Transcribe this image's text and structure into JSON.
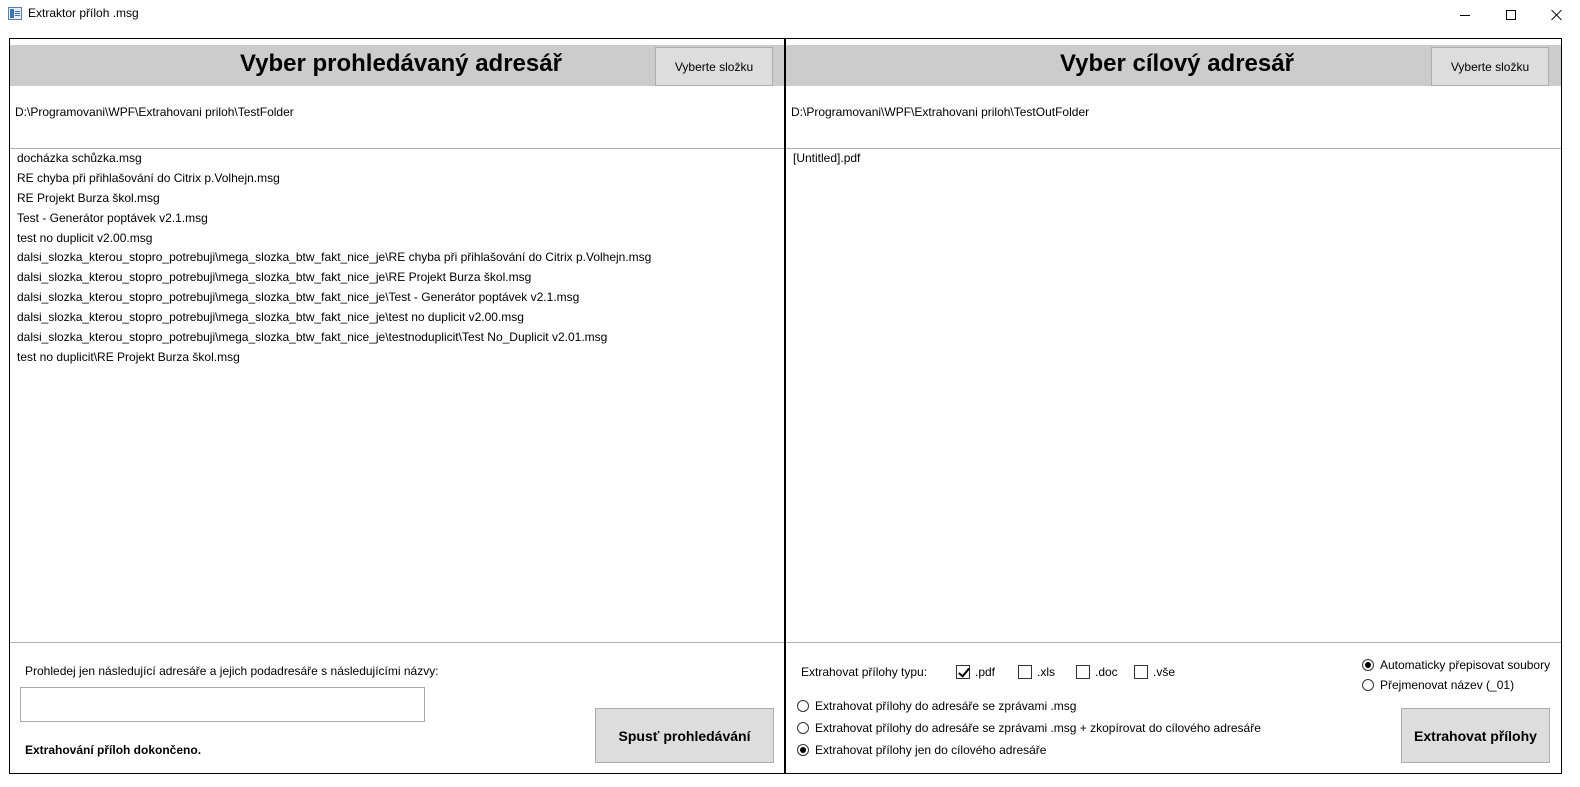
{
  "window": {
    "title": "Extraktor příloh .msg",
    "minimize_icon": "minimize-icon",
    "maximize_icon": "maximize-icon",
    "close_icon": "close-icon"
  },
  "left_panel": {
    "title": "Vyber prohledávaný adresář",
    "browse_label": "Vyberte složku",
    "path": "D:\\Programovani\\WPF\\Extrahovani priloh\\TestFolder",
    "files": [
      "docházka schůzka.msg",
      "RE chyba při přihlašování do Citrix p.Volhejn.msg",
      "RE Projekt Burza škol.msg",
      "Test - Generátor poptávek v2.1.msg",
      "test no duplicit v2.00.msg",
      "dalsi_slozka_kterou_stopro_potrebuji\\mega_slozka_btw_fakt_nice_je\\RE chyba při přihlašování do Citrix p.Volhejn.msg",
      "dalsi_slozka_kterou_stopro_potrebuji\\mega_slozka_btw_fakt_nice_je\\RE Projekt Burza škol.msg",
      "dalsi_slozka_kterou_stopro_potrebuji\\mega_slozka_btw_fakt_nice_je\\Test - Generátor poptávek v2.1.msg",
      "dalsi_slozka_kterou_stopro_potrebuji\\mega_slozka_btw_fakt_nice_je\\test no duplicit v2.00.msg",
      "dalsi_slozka_kterou_stopro_potrebuji\\mega_slozka_btw_fakt_nice_je\\testnoduplicit\\Test No_Duplicit v2.01.msg",
      "test no duplicit\\RE Projekt Burza škol.msg"
    ],
    "filter_label": "Prohledej jen následující adresáře a jejich podadresáře s následujícími názvy:",
    "filter_value": "",
    "status": "Extrahování příloh dokončeno.",
    "scan_label": "Spusť prohledávání"
  },
  "right_panel": {
    "title": "Vyber cílový adresář",
    "browse_label": "Vyberte složku",
    "path": "D:\\Programovani\\WPF\\Extrahovani priloh\\TestOutFolder",
    "files": [
      "[Untitled].pdf"
    ],
    "type_label": "Extrahovat přílohy typu:",
    "types": [
      {
        "label": ".pdf",
        "checked": true
      },
      {
        "label": ".xls",
        "checked": false
      },
      {
        "label": ".doc",
        "checked": false
      },
      {
        "label": ".vše",
        "checked": false
      }
    ],
    "mode_options": [
      {
        "label": "Extrahovat přílohy do adresáře se zprávami .msg",
        "selected": false
      },
      {
        "label": "Extrahovat přílohy do adresáře se zprávami .msg + zkopírovat do cílového adresáře",
        "selected": false
      },
      {
        "label": "Extrahovat přílohy jen do cílového adresáře",
        "selected": true
      }
    ],
    "overwrite_options": [
      {
        "label": "Automaticky přepisovat soubory",
        "selected": true
      },
      {
        "label": "Přejmenovat název (_01)",
        "selected": false
      }
    ],
    "extract_label": "Extrahovat přílohy"
  }
}
